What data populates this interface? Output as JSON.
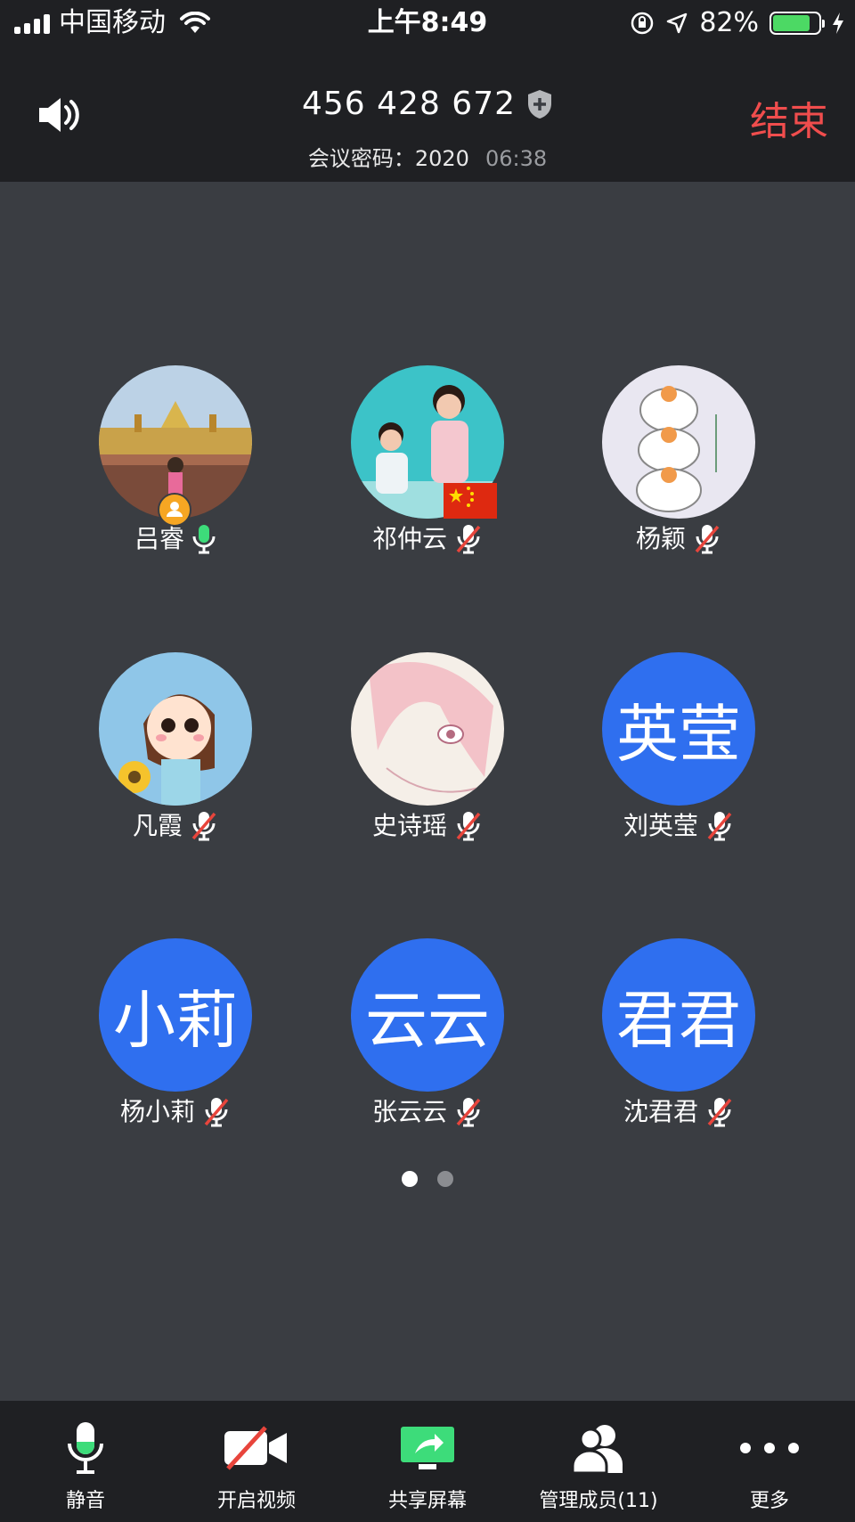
{
  "status_bar": {
    "carrier": "中国移动",
    "time": "上午8:49",
    "battery": "82%",
    "battery_level": 0.82
  },
  "header": {
    "meeting_id": "456 428 672",
    "password_label": "会议密码：2020",
    "timer": "06:38",
    "end_label": "结束"
  },
  "participants": [
    {
      "name": "吕睿",
      "mic": "on",
      "avatar": "photo-temple",
      "host": true
    },
    {
      "name": "祁仲云",
      "mic": "off",
      "avatar": "photo-family",
      "flag": true
    },
    {
      "name": "杨颖",
      "mic": "off",
      "avatar": "photo-cats"
    },
    {
      "name": "凡霞",
      "mic": "off",
      "avatar": "photo-cartoon-girl"
    },
    {
      "name": "史诗瑶",
      "mic": "off",
      "avatar": "photo-anime"
    },
    {
      "name": "刘英莹",
      "mic": "off",
      "avatar_text": "英莹"
    },
    {
      "name": "杨小莉",
      "mic": "off",
      "avatar_text": "小莉"
    },
    {
      "name": "张云云",
      "mic": "off",
      "avatar_text": "云云"
    },
    {
      "name": "沈君君",
      "mic": "off",
      "avatar_text": "君君"
    }
  ],
  "pager": {
    "pages": 2,
    "current": 1
  },
  "toolbar": {
    "mute_label": "静音",
    "video_label": "开启视频",
    "share_label": "共享屏幕",
    "members_label": "管理成员(11)",
    "more_label": "更多"
  },
  "colors": {
    "accent_blue": "#2f6fef",
    "end_red": "#f04d4d",
    "mic_green": "#3ddc7a",
    "muted_red": "#e8453c"
  }
}
